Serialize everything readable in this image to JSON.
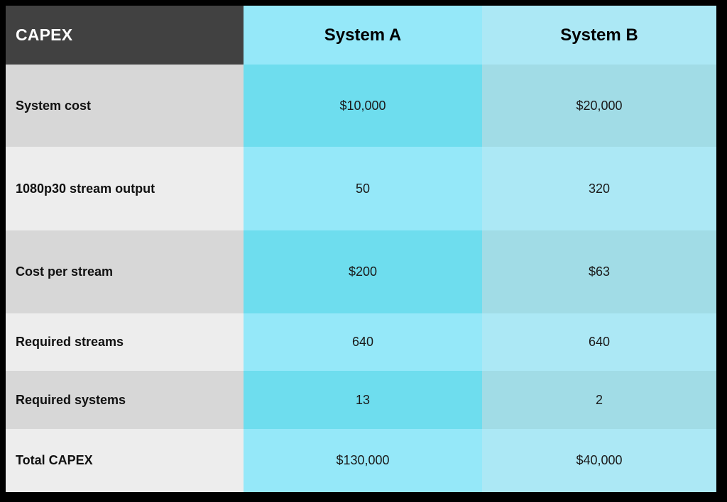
{
  "table": {
    "corner_title": "CAPEX",
    "columns": [
      {
        "key": "label",
        "label": "CAPEX"
      },
      {
        "key": "system_a",
        "label": "System A"
      },
      {
        "key": "system_b",
        "label": "System B"
      }
    ],
    "rows": [
      {
        "label": "System cost",
        "system_a": "$10,000",
        "system_b": "$20,000"
      },
      {
        "label": "1080p30 stream output",
        "system_a": "50",
        "system_b": "320"
      },
      {
        "label": "Cost per stream",
        "system_a": "$200",
        "system_b": "$63"
      },
      {
        "label": "Required streams",
        "system_a": "640",
        "system_b": "640"
      },
      {
        "label": "Required systems",
        "system_a": "13",
        "system_b": "2"
      },
      {
        "label": "Total CAPEX",
        "system_a": "$130,000",
        "system_b": "$40,000"
      }
    ]
  },
  "colors": {
    "header_label_bg": "#414141",
    "header_label_text": "#ffffff",
    "system_a_light": "#95e8f9",
    "system_a_dark": "#6eddee",
    "system_b_light": "#ace8f5",
    "system_b_dark": "#a1dce6",
    "label_light": "#ededed",
    "label_dark": "#d7d7d7",
    "frame": "#000000"
  }
}
